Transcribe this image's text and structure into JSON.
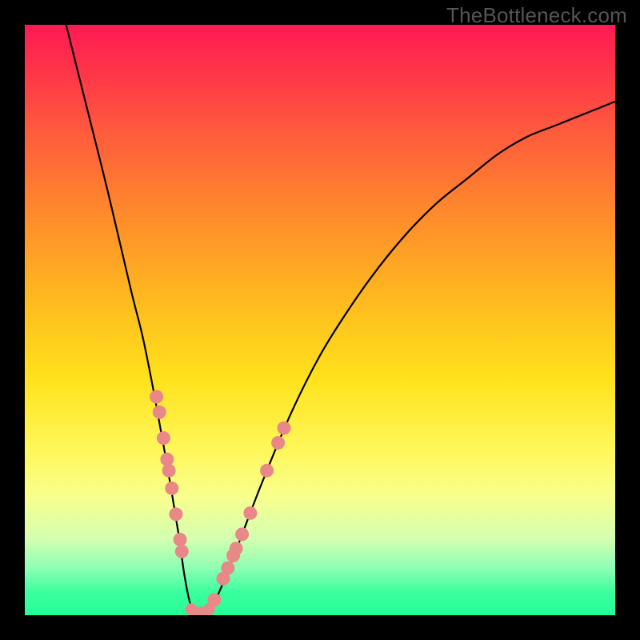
{
  "watermark": "TheBottleneck.com",
  "chart_data": {
    "type": "line",
    "title": "",
    "xlabel": "",
    "ylabel": "",
    "xlim": [
      0,
      100
    ],
    "ylim": [
      0,
      100
    ],
    "grid": false,
    "legend": false,
    "series": [
      {
        "name": "main-curve",
        "color": "#000000",
        "x": [
          7,
          10,
          14,
          18,
          20,
          22,
          24,
          26,
          27,
          28,
          29,
          30,
          32,
          35,
          40,
          45,
          50,
          55,
          60,
          65,
          70,
          75,
          80,
          85,
          90,
          95,
          100
        ],
        "y": [
          100,
          88,
          72,
          55,
          47,
          37,
          26,
          14,
          7,
          2,
          0,
          0,
          2,
          9,
          22,
          34,
          44,
          52,
          59,
          65,
          70,
          74,
          78,
          81,
          83,
          85,
          87
        ]
      }
    ],
    "scatter": [
      {
        "name": "left-arm-dots",
        "color": "#e98888",
        "points": [
          {
            "x": 22.3,
            "y": 37.0
          },
          {
            "x": 22.8,
            "y": 34.4
          },
          {
            "x": 23.5,
            "y": 30.0
          },
          {
            "x": 24.1,
            "y": 26.4
          },
          {
            "x": 24.4,
            "y": 24.5
          },
          {
            "x": 24.9,
            "y": 21.5
          },
          {
            "x": 25.6,
            "y": 17.1
          },
          {
            "x": 26.3,
            "y": 12.8
          },
          {
            "x": 26.6,
            "y": 10.8
          }
        ]
      },
      {
        "name": "right-arm-dots",
        "color": "#e98888",
        "points": [
          {
            "x": 32.1,
            "y": 2.6
          },
          {
            "x": 33.6,
            "y": 6.2
          },
          {
            "x": 34.4,
            "y": 8.0
          },
          {
            "x": 35.3,
            "y": 10.1
          },
          {
            "x": 35.8,
            "y": 11.3
          },
          {
            "x": 36.8,
            "y": 13.7
          },
          {
            "x": 38.2,
            "y": 17.3
          },
          {
            "x": 41.0,
            "y": 24.5
          },
          {
            "x": 42.9,
            "y": 29.2
          },
          {
            "x": 43.9,
            "y": 31.7
          }
        ]
      },
      {
        "name": "trough-dots",
        "color": "#e98888",
        "points": [
          {
            "x": 28.2,
            "y": 1.0
          },
          {
            "x": 28.7,
            "y": 0.6
          },
          {
            "x": 29.2,
            "y": 0.4
          },
          {
            "x": 29.7,
            "y": 0.4
          },
          {
            "x": 30.2,
            "y": 0.4
          },
          {
            "x": 30.7,
            "y": 0.6
          },
          {
            "x": 31.2,
            "y": 1.0
          }
        ]
      }
    ],
    "gradient_stops": [
      {
        "pos": 0.0,
        "color": "#ff1a55"
      },
      {
        "pos": 0.18,
        "color": "#ff5a3d"
      },
      {
        "pos": 0.46,
        "color": "#ffb81f"
      },
      {
        "pos": 0.72,
        "color": "#fff75a"
      },
      {
        "pos": 0.92,
        "color": "#8effb3"
      },
      {
        "pos": 1.0,
        "color": "#24ff97"
      }
    ]
  }
}
